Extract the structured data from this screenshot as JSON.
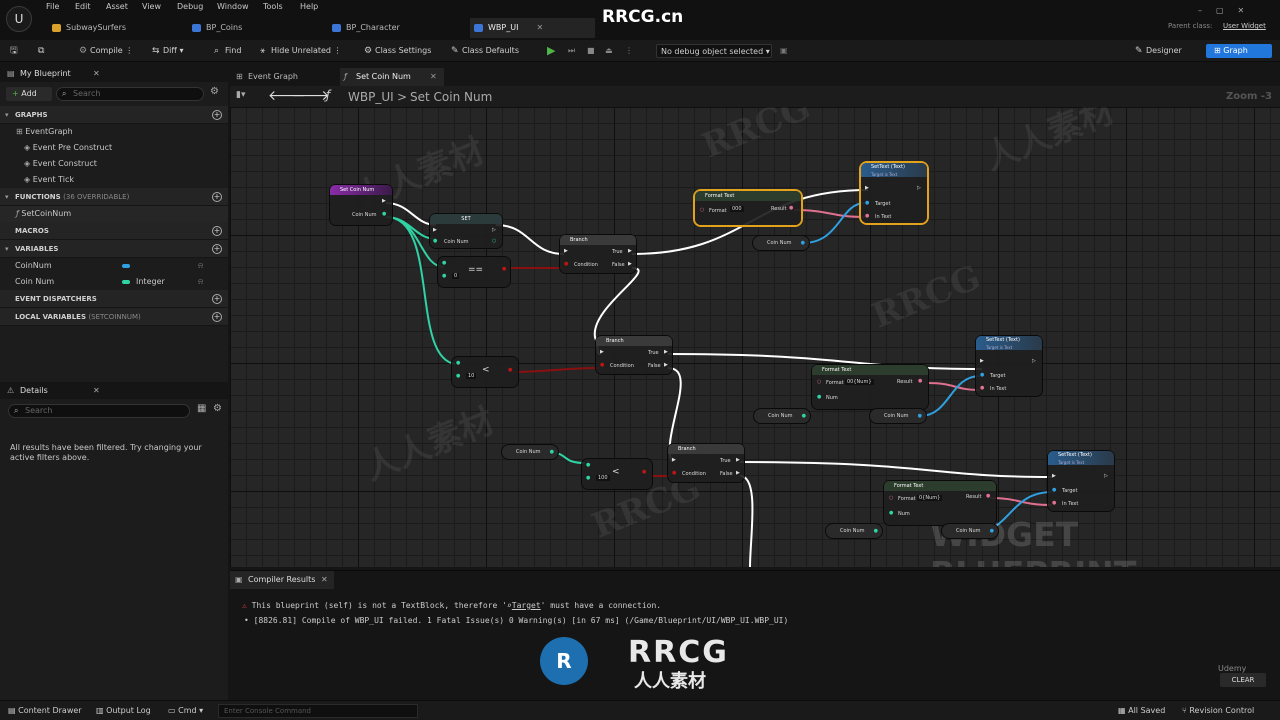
{
  "menu": [
    "File",
    "Edit",
    "Asset",
    "View",
    "Debug",
    "Window",
    "Tools",
    "Help"
  ],
  "tabs": [
    {
      "label": "SubwaySurfers",
      "color": "#d9a02c"
    },
    {
      "label": "BP_Coins",
      "color": "#3b76d6"
    },
    {
      "label": "BP_Character",
      "color": "#3b76d6"
    },
    {
      "label": "WBP_UI",
      "color": "#3b76d6"
    }
  ],
  "parent_class": {
    "label": "Parent class:",
    "value": "User Widget"
  },
  "toolbar": {
    "compile": "Compile",
    "diff": "Diff",
    "find": "Find",
    "hide_unrelated": "Hide Unrelated",
    "class_settings": "Class Settings",
    "class_defaults": "Class Defaults",
    "debug_object": "No debug object selected",
    "designer": "Designer",
    "graph": "Graph"
  },
  "my_blueprint": {
    "title": "My Blueprint",
    "add": "Add",
    "search_placeholder": "Search",
    "graphs": "GRAPHS",
    "graph_items": [
      "EventGraph",
      "Event Pre Construct",
      "Event Construct",
      "Event Tick"
    ],
    "functions": "FUNCTIONS",
    "functions_count": "(36 OVERRIDABLE)",
    "function_items": [
      "SetCoinNum"
    ],
    "macros": "MACROS",
    "variables": "VARIABLES",
    "var1": "CoinNum",
    "var2": "Coin Num",
    "var2_type": "Integer",
    "dispatchers": "EVENT DISPATCHERS",
    "local_vars": "LOCAL VARIABLES",
    "local_vars_scope": "(SETCOINNUM)"
  },
  "details": {
    "title": "Details",
    "search_placeholder": "Search",
    "message": "All results have been filtered. Try changing your active filters above."
  },
  "doc_tabs": [
    "Event Graph",
    "Set Coin Num"
  ],
  "breadcrumb": {
    "root": "WBP_UI",
    "sep": ">",
    "leaf": "Set Coin Num"
  },
  "zoom": "Zoom -3",
  "nodes": {
    "entry": "Set Coin Num",
    "coin_num": "Coin Num",
    "set": "SET",
    "branch": "Branch",
    "true": "True",
    "false": "False",
    "condition": "Condition",
    "format_text": "Format Text",
    "format": "Format",
    "result": "Result",
    "num": "Num",
    "settext": "SetText (Text)",
    "target_is_text": "Target is Text",
    "target": "Target",
    "in_text": "In Text",
    "eq": "==",
    "lt": "<",
    "v0": "0",
    "v10": "10",
    "v100": "100",
    "fmt1": "000",
    "fmt2": "00{Num}",
    "fmt3": "0{Num}"
  },
  "widget_watermark": "WIDGET BLUEPRINT",
  "compiler": {
    "title": "Compiler Results",
    "error_pre": "This blueprint (self) is not a TextBlock, therefore '",
    "error_link": "Target",
    "error_post": "' must have a connection.",
    "log": "[8826.81] Compile of WBP_UI failed. 1 Fatal Issue(s) 0 Warning(s) [in 67 ms] (/Game/Blueprint/UI/WBP_UI.WBP_UI)",
    "clear": "CLEAR"
  },
  "status": {
    "content_drawer": "Content Drawer",
    "output_log": "Output Log",
    "cmd": "Cmd",
    "console_placeholder": "Enter Console Command",
    "all_saved": "All Saved",
    "revision_control": "Revision Control"
  },
  "watermarks": {
    "site": "RRCG.cn",
    "brand": "RRCG",
    "brand_cn": "人人素材",
    "udemy": "Udemy",
    "cn": "人人素材"
  },
  "colors": {
    "accent": "#2277dd",
    "exec": "#ffffff",
    "integer": "#2fd3a4",
    "text": "#e0708f",
    "bool": "#b30f0f"
  }
}
